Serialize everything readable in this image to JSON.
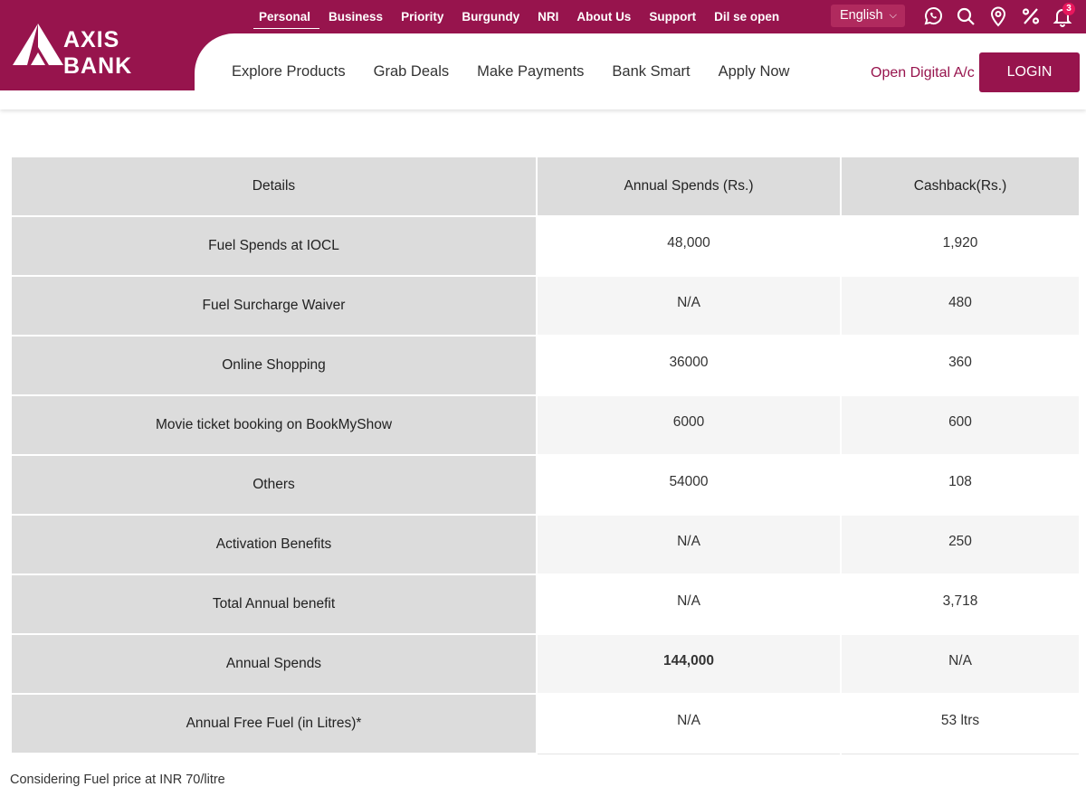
{
  "brand": {
    "name": "AXIS BANK"
  },
  "topnav": {
    "items": [
      "Personal",
      "Business",
      "Priority",
      "Burgundy",
      "NRI",
      "About Us",
      "Support",
      "Dil se open"
    ],
    "active_index": 0
  },
  "language": {
    "selected": "English"
  },
  "notifications": {
    "count": "3"
  },
  "mainnav": {
    "items": [
      "Explore Products",
      "Grab Deals",
      "Make Payments",
      "Bank Smart",
      "Apply Now"
    ]
  },
  "actions": {
    "open_account": "Open Digital A/c",
    "login": "LOGIN"
  },
  "colors": {
    "brand": "#97144d",
    "badge": "#e8175d",
    "header_cell": "#dcdcdc"
  },
  "table": {
    "headers": [
      "Details",
      "Annual Spends (Rs.)",
      "Cashback(Rs.)"
    ],
    "rows": [
      {
        "detail": "Fuel Spends at IOCL",
        "spends": "48,000",
        "cashback": "1,920"
      },
      {
        "detail": "Fuel Surcharge Waiver",
        "spends": "N/A",
        "cashback": "480"
      },
      {
        "detail": "Online Shopping",
        "spends": "36000",
        "cashback": "360"
      },
      {
        "detail": "Movie ticket booking on BookMyShow",
        "spends": "6000",
        "cashback": "600"
      },
      {
        "detail": "Others",
        "spends": "54000",
        "cashback": "108"
      },
      {
        "detail": "Activation Benefits",
        "spends": "N/A",
        "cashback": "250"
      },
      {
        "detail": "Total Annual benefit",
        "spends": "N/A",
        "cashback": "3,718"
      },
      {
        "detail": "Annual Spends",
        "spends": "144,000",
        "cashback": "N/A",
        "spends_bold": true
      },
      {
        "detail": "Annual Free Fuel (in Litres)*",
        "spends": "N/A",
        "cashback": "53 ltrs"
      }
    ]
  },
  "footnote": "Considering Fuel price at INR 70/litre"
}
